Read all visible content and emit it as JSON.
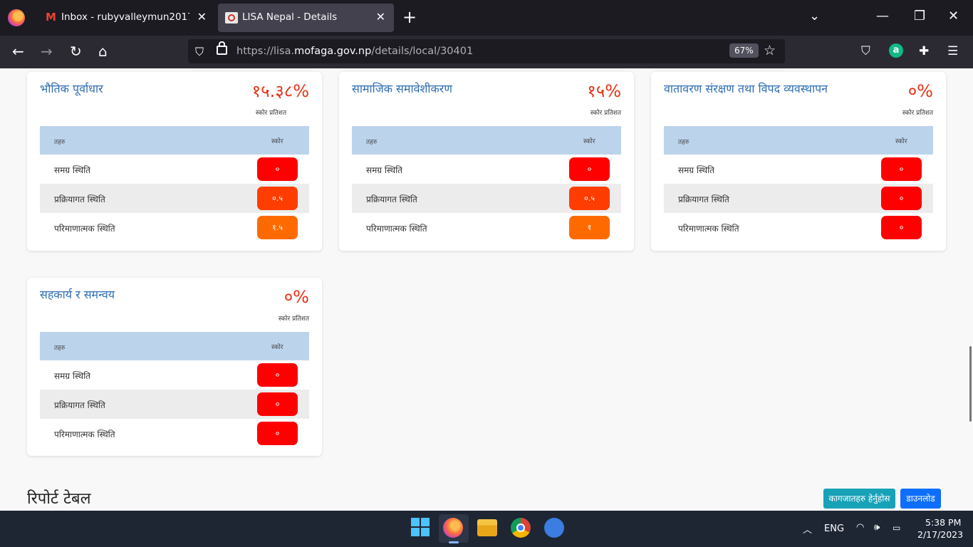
{
  "browser": {
    "tabs": [
      {
        "title": "Inbox - rubyvalleymun2017@gmail.com",
        "icon": "gmail-icon"
      },
      {
        "title": "LISA Nepal - Details",
        "icon": "lisa-logo-icon"
      }
    ],
    "url_prefix": "https://lisa.",
    "url_domain": "mofaga.gov.np",
    "url_path": "/details/local/30401",
    "zoom": "67%"
  },
  "cards": [
    {
      "title": "भौतिक पूर्वाधार",
      "score": "१५.३८%",
      "score_label": "स्कोर प्रतिशत",
      "col_header_1": "तहरु",
      "col_header_2": "स्कोर",
      "rows": [
        {
          "label": "समग्र स्थिति",
          "value": "०"
        },
        {
          "label": "प्रक्रियागत स्थिति",
          "value": "०.५"
        },
        {
          "label": "परिमाणात्मक स्थिति",
          "value": "१.५"
        }
      ]
    },
    {
      "title": "सामाजिक समावेशीकरण",
      "score": "१५%",
      "score_label": "स्कोर प्रतिशत",
      "col_header_1": "तहरु",
      "col_header_2": "स्कोर",
      "rows": [
        {
          "label": "समग्र स्थिति",
          "value": "०"
        },
        {
          "label": "प्रक्रियागत स्थिति",
          "value": "०.५"
        },
        {
          "label": "परिमाणात्मक स्थिति",
          "value": "१"
        }
      ]
    },
    {
      "title": "वातावरण संरक्षण तथा विपद व्यवस्थापन",
      "score": "०%",
      "score_label": "स्कोर प्रतिशत",
      "col_header_1": "तहरु",
      "col_header_2": "स्कोर",
      "rows": [
        {
          "label": "समग्र स्थिति",
          "value": "०"
        },
        {
          "label": "प्रक्रियागत स्थिति",
          "value": "०"
        },
        {
          "label": "परिमाणात्मक स्थिति",
          "value": "०"
        }
      ]
    },
    {
      "title": "सहकार्य र समन्वय",
      "score": "०%",
      "score_label": "स्कोर प्रतिशत",
      "col_header_1": "तहरु",
      "col_header_2": "स्कोर",
      "rows": [
        {
          "label": "समग्र स्थिति",
          "value": "०"
        },
        {
          "label": "प्रक्रियागत स्थिति",
          "value": "०"
        },
        {
          "label": "परिमाणात्मक स्थिति",
          "value": "०"
        }
      ]
    }
  ],
  "report": {
    "title": "रिपोर्ट टेबल",
    "view_docs_button": "कागजातहरु हेर्नुहोस",
    "download_button": "डाउनलोड"
  },
  "taskbar": {
    "language": "ENG",
    "time": "5:38 PM",
    "date": "2/17/2023"
  },
  "colors": {
    "score_red": "#ff0000",
    "score_orange_red": "#ff3d00",
    "score_orange": "#ff6a00",
    "title_blue": "#2f6db3",
    "table_header": "#bcd3ec"
  }
}
